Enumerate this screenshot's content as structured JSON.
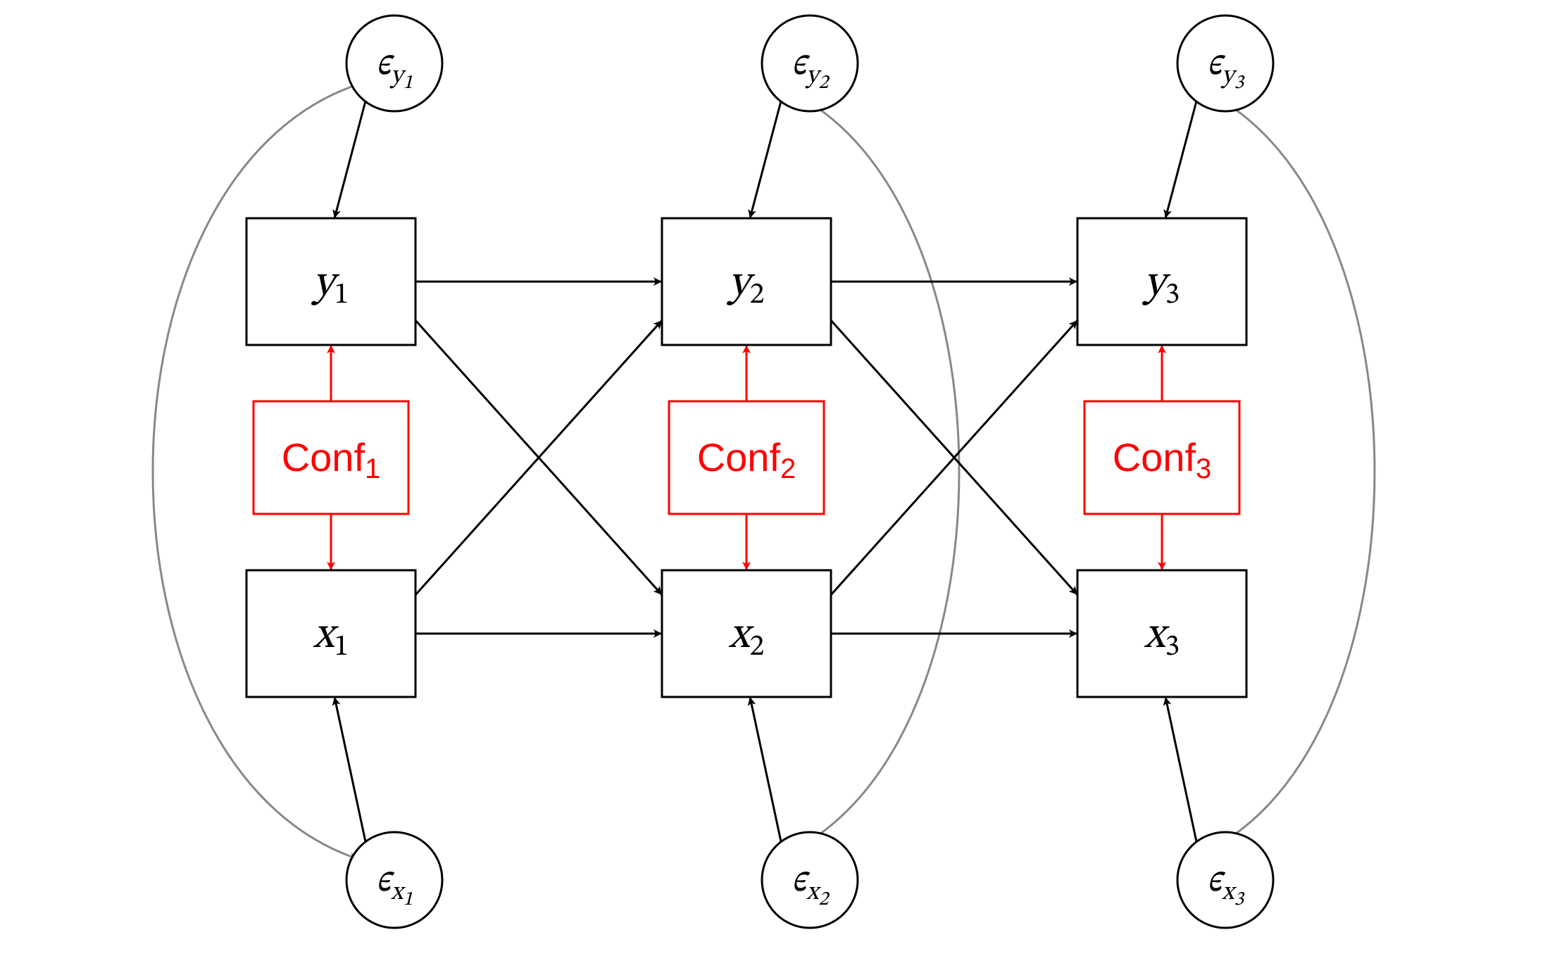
{
  "nodes": {
    "y1": {
      "var": "y",
      "sub": "1"
    },
    "y2": {
      "var": "y",
      "sub": "2"
    },
    "y3": {
      "var": "y",
      "sub": "3"
    },
    "x1": {
      "var": "x",
      "sub": "1"
    },
    "x2": {
      "var": "x",
      "sub": "2"
    },
    "x3": {
      "var": "x",
      "sub": "3"
    },
    "conf1": {
      "label": "Conf",
      "sub": "1"
    },
    "conf2": {
      "label": "Conf",
      "sub": "2"
    },
    "conf3": {
      "label": "Conf",
      "sub": "3"
    },
    "eps_y1": {
      "sym": "ϵ",
      "sub": "y",
      "sub2": "1"
    },
    "eps_y2": {
      "sym": "ϵ",
      "sub": "y",
      "sub2": "2"
    },
    "eps_y3": {
      "sym": "ϵ",
      "sub": "y",
      "sub2": "3"
    },
    "eps_x1": {
      "sym": "ϵ",
      "sub": "x",
      "sub2": "1"
    },
    "eps_x2": {
      "sym": "ϵ",
      "sub": "x",
      "sub2": "2"
    },
    "eps_x3": {
      "sym": "ϵ",
      "sub": "x",
      "sub2": "3"
    }
  }
}
